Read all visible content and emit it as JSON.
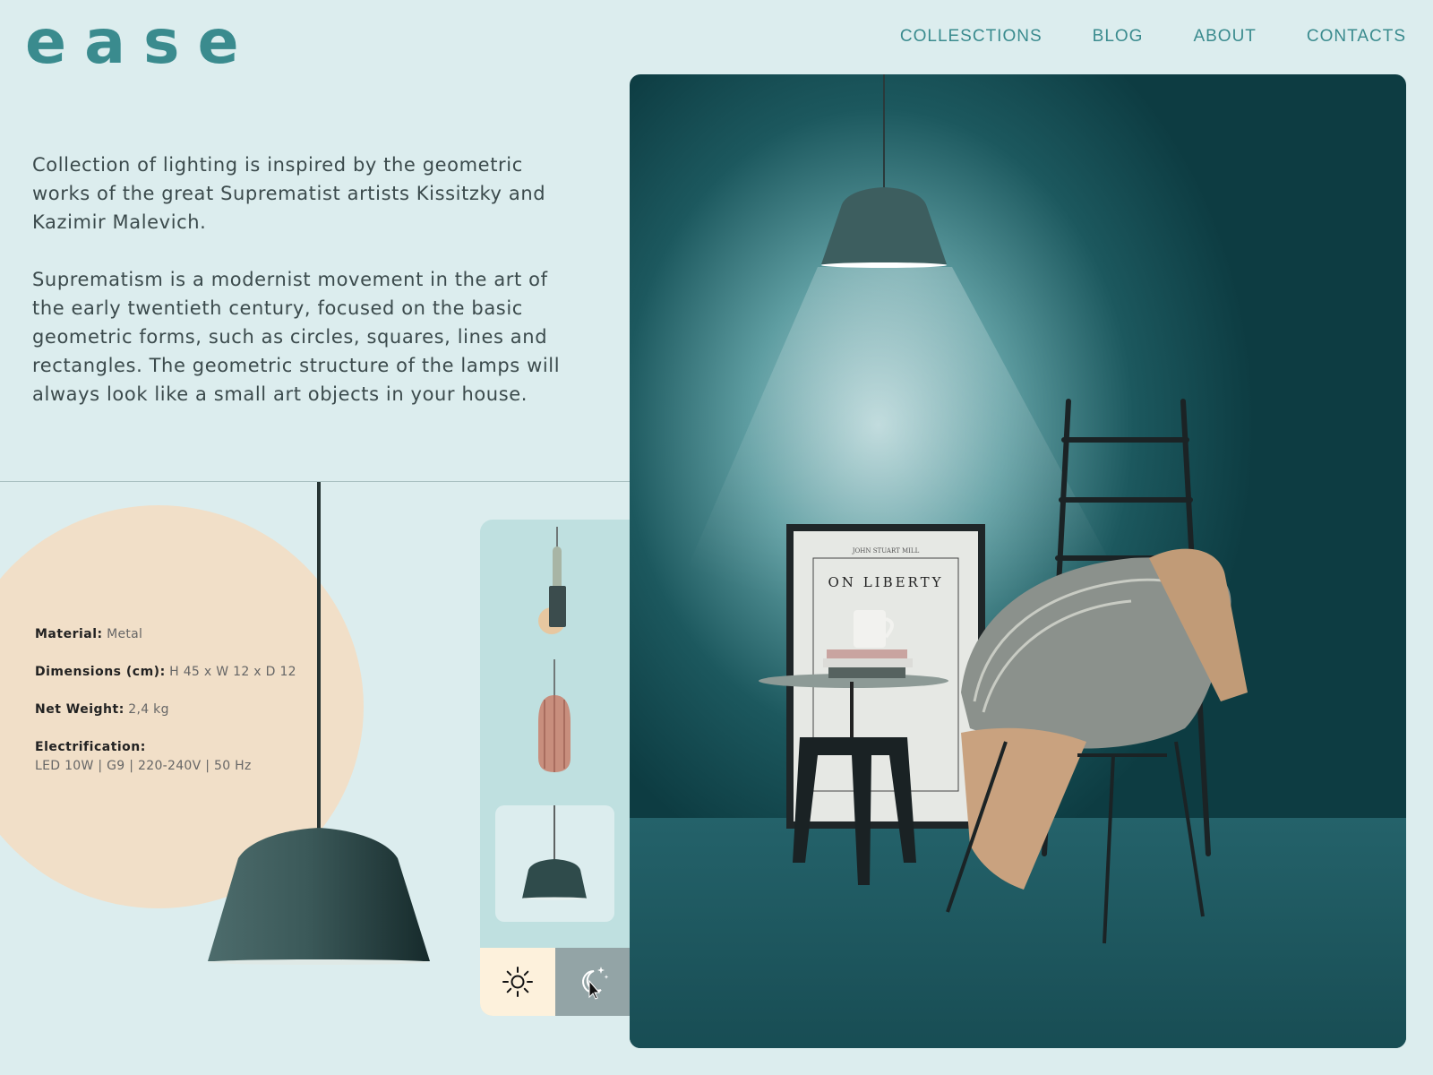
{
  "brand": {
    "logo": "ease"
  },
  "nav": {
    "items": [
      {
        "label": "COLLESCTIONS"
      },
      {
        "label": "BLOG"
      },
      {
        "label": "ABOUT"
      },
      {
        "label": "CONTACTS"
      }
    ]
  },
  "intro": {
    "paragraph1": "Collection of lighting is inspired by the geometric works of the great Suprematist artists Kissitzky and Kazimir Malevich.",
    "paragraph2": "Suprematism is a modernist movement in the art of the early twentieth century, focused on the basic geometric forms, such as circles, squares, lines and rectangles. The geometric structure of the lamps will always look like a small art objects in your house."
  },
  "specs": {
    "material": {
      "label": "Material:",
      "value": "Metal"
    },
    "dimensions": {
      "label": "Dimensions (cm):",
      "value": "H 45 x W 12 x D 12"
    },
    "weight": {
      "label": "Net Weight:",
      "value": "2,4 kg"
    },
    "electrification": {
      "label": "Electrification:",
      "value": "LED 10W | G9 |  220-240V | 50 Hz"
    }
  },
  "selector": {
    "thumbnails": [
      {
        "icon": "cylinder-pendant-lamp-icon",
        "active": false
      },
      {
        "icon": "copper-pendant-lamp-icon",
        "active": false
      },
      {
        "icon": "dome-pendant-lamp-icon",
        "active": true
      }
    ],
    "modes": [
      {
        "icon": "sun-icon",
        "active": false
      },
      {
        "icon": "moon-stars-icon",
        "active": true
      }
    ]
  },
  "hero": {
    "poster_title": "ON LIBERTY",
    "poster_author": "JOHN STUART MILL"
  },
  "colors": {
    "accent": "#3a8b8e",
    "background": "#dcedee",
    "circle": "#f1dfc8",
    "panel": "#bfe0e0"
  }
}
